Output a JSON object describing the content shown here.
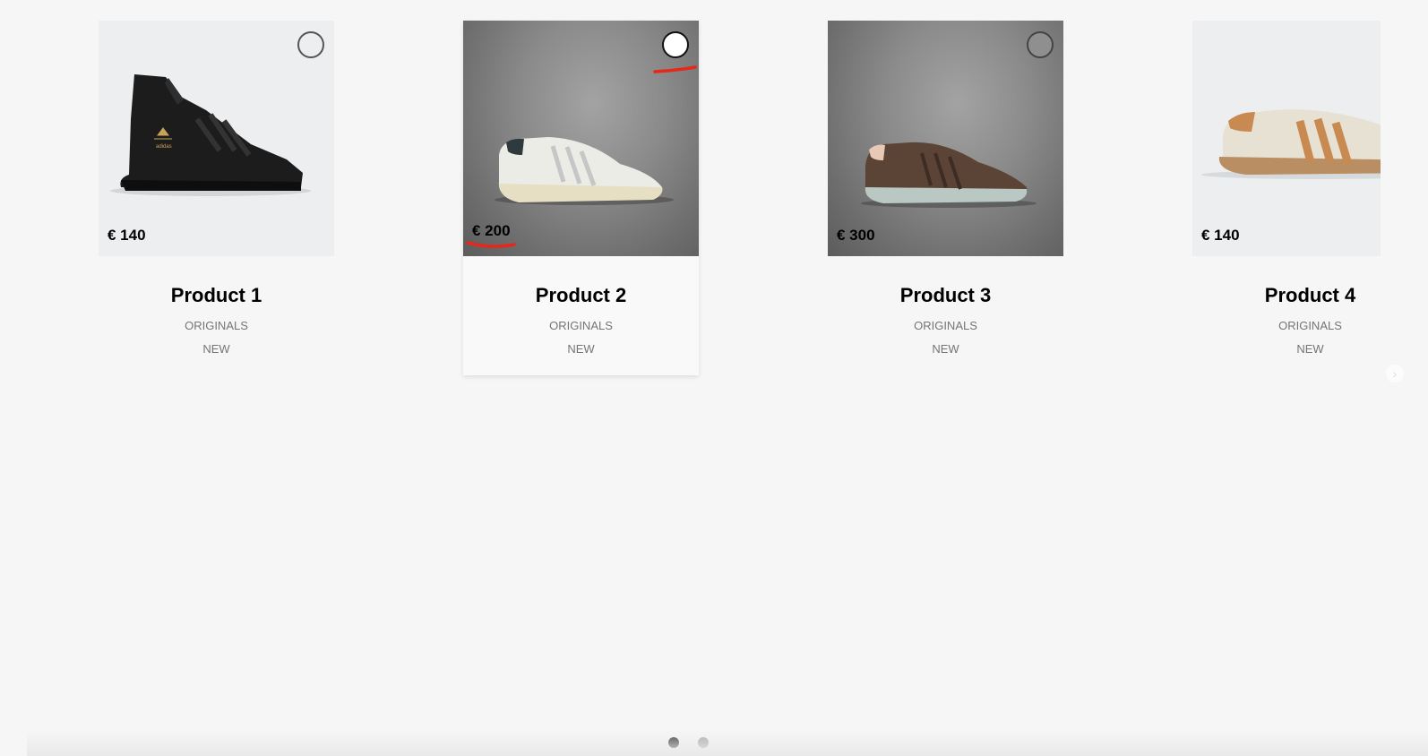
{
  "products": [
    {
      "name": "Product 1",
      "price": "€ 140",
      "line1": "ORIGINALS",
      "line2": "NEW",
      "shoe": "black-high-top-sneaker"
    },
    {
      "name": "Product 2",
      "price": "€ 200",
      "line1": "ORIGINALS",
      "line2": "NEW",
      "shoe": "white-low-top-sneaker"
    },
    {
      "name": "Product 3",
      "price": "€ 300",
      "line1": "ORIGINALS",
      "line2": "NEW",
      "shoe": "brown-suede-sneaker"
    },
    {
      "name": "Product 4",
      "price": "€ 140",
      "line1": "ORIGINALS",
      "line2": "NEW",
      "shoe": "cream-tan-sneaker"
    }
  ],
  "carousel": {
    "next_icon": "chevron-right-icon",
    "pagination": {
      "pages": 2,
      "active": 1
    }
  },
  "colors": {
    "annotation": "#e8261a",
    "background": "#f6f6f6"
  }
}
